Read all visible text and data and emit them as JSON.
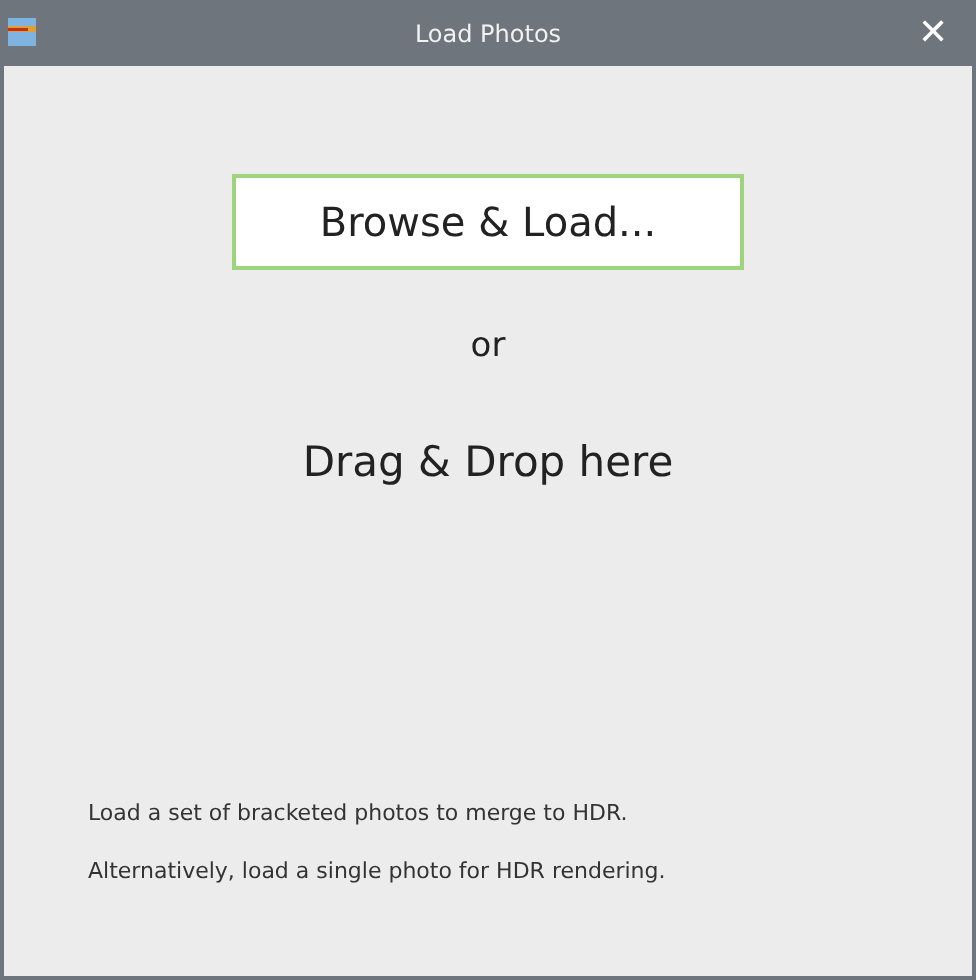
{
  "window": {
    "title": "Load Photos",
    "close": "✕"
  },
  "browse_button": "Browse & Load...",
  "separator": "or",
  "drop_hint": "Drag & Drop here",
  "notes": [
    "Load a set of bracketed photos to merge to HDR.",
    "Alternatively, load a single photo for HDR rendering."
  ]
}
